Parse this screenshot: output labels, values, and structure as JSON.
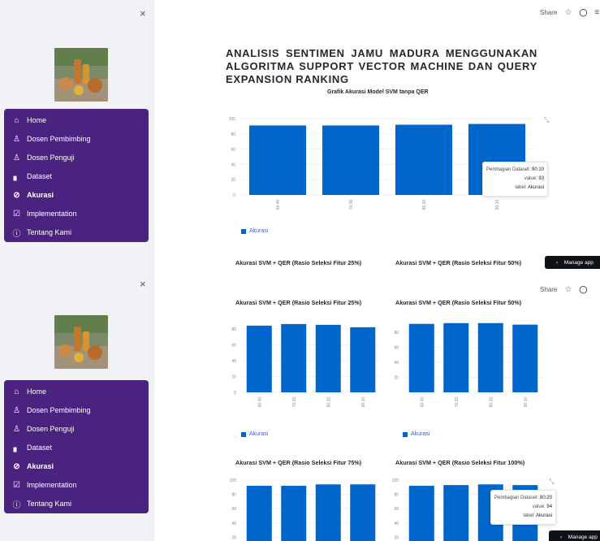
{
  "sidebar": {
    "close_icon": "×",
    "items": [
      {
        "icon": "home-icon",
        "glyph": "⌂",
        "label": "Home"
      },
      {
        "icon": "user-icon",
        "glyph": "♙",
        "label": "Dosen Pembimbing"
      },
      {
        "icon": "user-icon",
        "glyph": "♙",
        "label": "Dosen Penguji"
      },
      {
        "icon": "bar-chart-icon",
        "glyph": "▖",
        "label": "Dataset"
      },
      {
        "icon": "check-circle-icon",
        "glyph": "⊘",
        "label": "Akurasi",
        "active": true
      },
      {
        "icon": "check-square-icon",
        "glyph": "☑",
        "label": "Implementation"
      },
      {
        "icon": "info-icon",
        "glyph": "ⓘ",
        "label": "Tentang Kami"
      }
    ]
  },
  "topbar": {
    "share": "Share",
    "star_glyph": "☆",
    "github_glyph": "◯",
    "menu_glyph": "≡"
  },
  "page_title": "ANALISIS SENTIMEN JAMU MADURA MENGGUNAKAN ALGORITMA SUPPORT VECTOR MACHINE DAN QUERY EXPANSION RANKING",
  "manage_app": "Manage app",
  "legend_label": "Akurasi",
  "accent": "#0066cc",
  "menu_bg": "#4a2280",
  "tooltips": [
    {
      "lines": [
        [
          "Pembagian Dataset",
          "90:10"
        ],
        [
          "value",
          "93"
        ],
        [
          "label",
          "Akurasi"
        ]
      ]
    },
    {
      "lines": [
        [
          "Pembagian Dataset",
          "80:20"
        ],
        [
          "value",
          "94"
        ],
        [
          "label",
          "Akurasi"
        ]
      ]
    }
  ],
  "chart_data": [
    {
      "type": "bar",
      "title": "Grafik Akurasi Model SVM tanpa QER",
      "categories": [
        "60:40",
        "70:30",
        "80:20",
        "90:10"
      ],
      "series": [
        {
          "name": "Akurasi",
          "values": [
            91,
            91,
            92,
            93
          ]
        }
      ],
      "ylim": [
        0,
        100
      ],
      "yticks": [
        0,
        20,
        40,
        60,
        80,
        100
      ],
      "grid": true,
      "legend": "bottom-left"
    },
    {
      "type": "bar",
      "title": "Akurasi SVM + QER (Rasio Seleksi Fitur 25%)",
      "categories": [
        "60:40",
        "70:30",
        "80:20",
        "90:10"
      ],
      "series": [
        {
          "name": "Akurasi",
          "values": [
            84,
            86,
            85,
            82
          ]
        }
      ],
      "ylim": [
        0,
        90
      ],
      "yticks": [
        0,
        20,
        40,
        60,
        80
      ],
      "grid": true,
      "legend": "bottom-left"
    },
    {
      "type": "bar",
      "title": "Akurasi SVM + QER (Rasio Seleksi Fitur 50%)",
      "categories": [
        "60:40",
        "70:30",
        "80:20",
        "90:10"
      ],
      "series": [
        {
          "name": "Akurasi",
          "values": [
            91,
            92,
            92,
            90
          ]
        }
      ],
      "ylim": [
        0,
        95
      ],
      "yticks": [
        20,
        40,
        60,
        80
      ],
      "grid": true,
      "legend": "bottom-left"
    },
    {
      "type": "bar",
      "title": "Akurasi SVM + QER (Rasio Seleksi Fitur 75%)",
      "categories": [
        "60:40",
        "70:30",
        "80:20",
        "90:10"
      ],
      "series": [
        {
          "name": "Akurasi",
          "values": [
            92,
            92,
            94,
            94
          ]
        }
      ],
      "ylim": [
        0,
        100
      ],
      "yticks": [
        20,
        40,
        60,
        80,
        100
      ],
      "grid": true
    },
    {
      "type": "bar",
      "title": "Akurasi SVM + QER (Rasio Seleksi Fitur 100%)",
      "categories": [
        "60:40",
        "70:30",
        "80:20",
        "90:10"
      ],
      "series": [
        {
          "name": "Akurasi",
          "values": [
            92,
            93,
            94,
            93
          ]
        }
      ],
      "ylim": [
        0,
        100
      ],
      "yticks": [
        20,
        40,
        60,
        80,
        100
      ],
      "grid": true
    }
  ]
}
